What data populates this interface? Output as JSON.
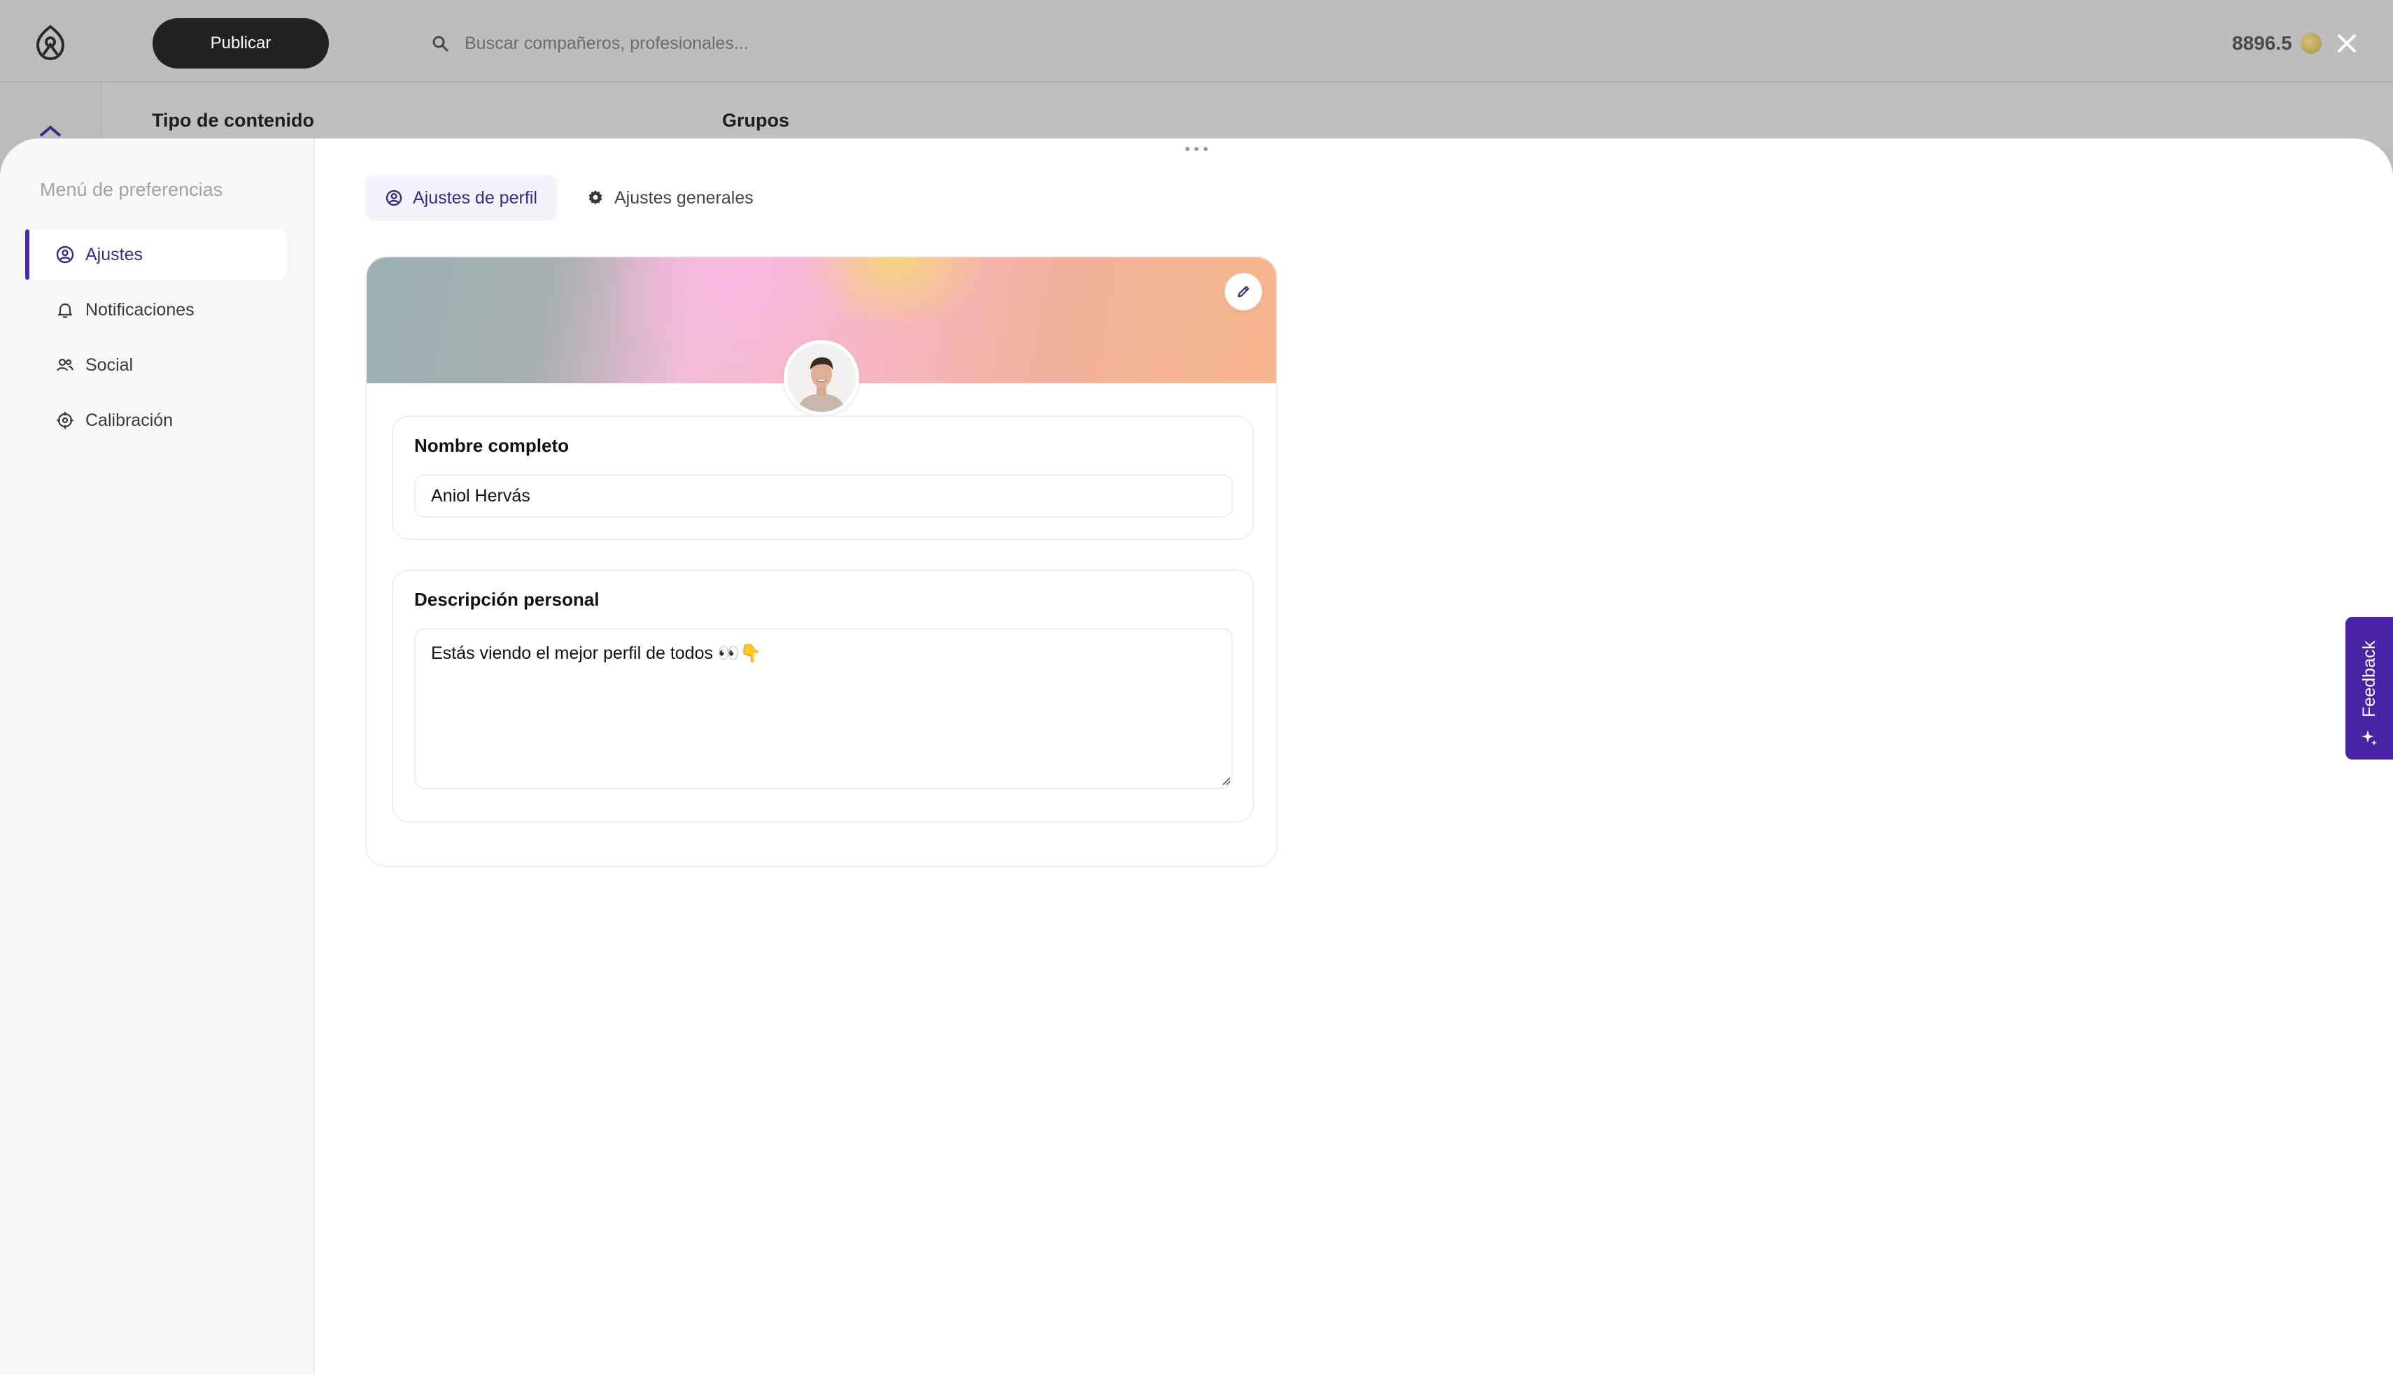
{
  "topbar": {
    "publish_label": "Publicar",
    "search_placeholder": "Buscar compañeros, profesionales...",
    "coins_value": "8896.5"
  },
  "background": {
    "content_type_label": "Tipo de contenido",
    "groups_label": "Grupos"
  },
  "preferences": {
    "title": "Menú de preferencias",
    "items": [
      {
        "label": "Ajustes",
        "icon": "user-circle-icon",
        "active": true
      },
      {
        "label": "Notificaciones",
        "icon": "bell-icon",
        "active": false
      },
      {
        "label": "Social",
        "icon": "users-icon",
        "active": false
      },
      {
        "label": "Calibración",
        "icon": "target-icon",
        "active": false
      }
    ]
  },
  "tabs": [
    {
      "label": "Ajustes de perfil",
      "icon": "user-circle-icon",
      "active": true
    },
    {
      "label": "Ajustes generales",
      "icon": "gear-icon",
      "active": false
    }
  ],
  "profile": {
    "full_name_label": "Nombre completo",
    "full_name_value": "Aniol Hervás",
    "description_label": "Descripción personal",
    "description_value": "Estás viendo el mejor perfil de todos 👀👇"
  },
  "feedback": {
    "label": "Feedback"
  },
  "colors": {
    "accent": "#4a22a6",
    "active_text": "#3d2a87",
    "overlay": "#bdbdbd"
  }
}
